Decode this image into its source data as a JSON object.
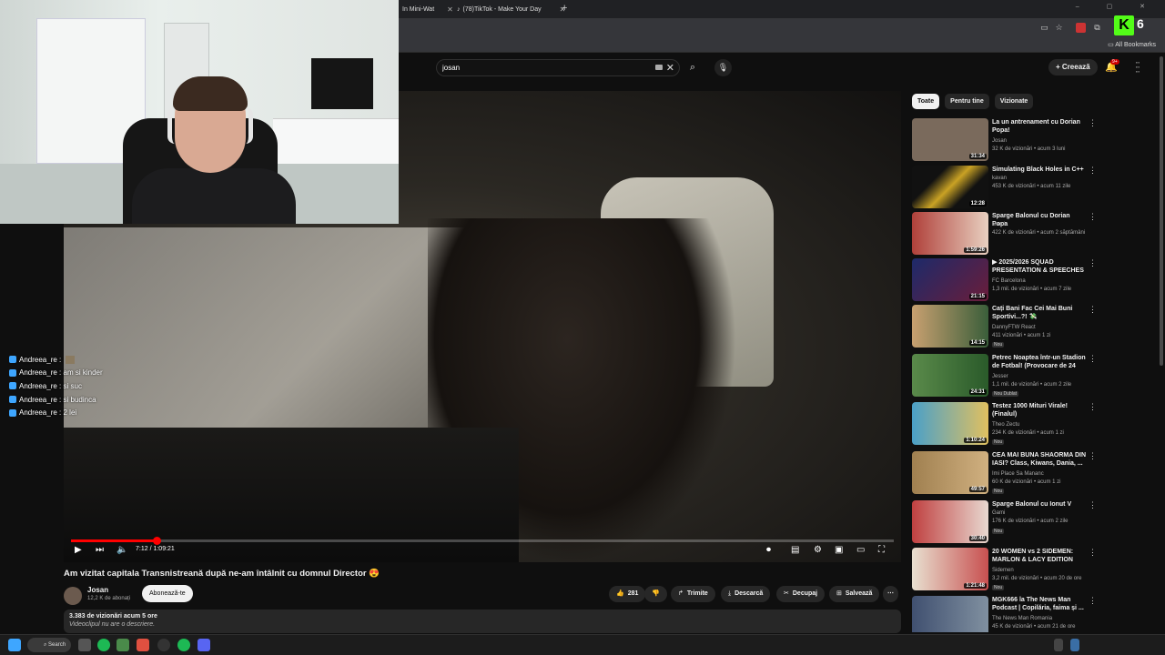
{
  "browser": {
    "tabs": [
      {
        "label": "In Mini-Wat"
      },
      {
        "label": "(78)TikTok - Make Your Day"
      }
    ],
    "all_bookmarks": "All Bookmarks"
  },
  "header": {
    "search_value": "josan",
    "create_label": "Creează",
    "notif_count": "9+"
  },
  "overlay": {
    "logo_letter": "K",
    "logo_number": "6"
  },
  "chat": [
    {
      "user": "Andreea_re :",
      "msg": ""
    },
    {
      "user": "Andreea_re :",
      "msg": "am si kinder"
    },
    {
      "user": "Andreea_re :",
      "msg": "si suc"
    },
    {
      "user": "Andreea_re :",
      "msg": "si budinca"
    },
    {
      "user": "Andreea_re :",
      "msg": "2 lei"
    }
  ],
  "player": {
    "time": "7:12 / 1:09:21",
    "progress": 0.104
  },
  "video": {
    "title": "Am vizitat capitala Transnistreană după ne-am întâlnit cu domnul Director 😍",
    "channel": "Josan",
    "subs": "12,2 K de abonați",
    "subscribe": "Abonează-te",
    "likes": "281",
    "share": "Trimite",
    "download": "Descarcă",
    "clip": "Decupaj",
    "save": "Salvează",
    "views_line": "3.383 de vizionări  acum 5 ore",
    "desc_line": "Videoclipul nu are o descriere."
  },
  "sidebar": {
    "chips": [
      "Toate",
      "Pentru tine",
      "Vizionate"
    ],
    "items": [
      {
        "title": "La un antrenament cu Dorian Popa!",
        "channel": "Josan",
        "meta": "32 K de vizionări • acum 3 luni",
        "duration": "31:34",
        "badge": "",
        "color": "#7a6a5c"
      },
      {
        "title": "Simulating Black Holes in C++",
        "channel": "kavan",
        "meta": "453 K de vizionări • acum 11 zile",
        "duration": "12:28",
        "badge": "",
        "color": "#c9a224"
      },
      {
        "title": "Sparge Balonul cu Dorian Popa",
        "channel": "Gami",
        "meta": "422 K de vizionări • acum 2 săptămâni",
        "duration": "1:59:26",
        "badge": "",
        "color": "#c8a48a"
      },
      {
        "title": "▶ 2025/2026 SQUAD PRESENTATION & SPEECHES | ...",
        "channel": "FC Barcelona",
        "meta": "1,3 mil. de vizionări • acum 7 zile",
        "duration": "21:15",
        "badge": "",
        "color": "#3a2a6a"
      },
      {
        "title": "Cați Bani Fac Cei Mai Buni Sportivi...?! 💸",
        "channel": "DannyFTW React",
        "meta": "411 vizionări • acum 1 zi",
        "duration": "14:15",
        "badge": "Nou",
        "color": "#4a5e3a"
      },
      {
        "title": "Petrec Noaptea într-un Stadion de Fotbal! (Provocare de 24 de...",
        "channel": "Jesser",
        "meta": "1,1 mil. de vizionări • acum 2 zile",
        "duration": "24:31",
        "badge": "Nou  Dublat",
        "color": "#3f6a3a"
      },
      {
        "title": "Testez 1000 Mituri Virale! (Finalul)",
        "channel": "Theo Zectu",
        "meta": "234 K de vizionări • acum 1 zi",
        "duration": "1:10:24",
        "badge": "Nou",
        "color": "#4aa0c8"
      },
      {
        "title": "CEA MAI BUNA SHAORMA DIN IASI? Class, Kiwans, Dania, ...",
        "channel": "Imi Place Sa Mananc",
        "meta": "60 K de vizionări • acum 1 zi",
        "duration": "49:57",
        "badge": "Nou",
        "color": "#a08050"
      },
      {
        "title": "Sparge Balonul cu Ionut V",
        "channel": "Gami",
        "meta": "176 K de vizionări • acum 2 zile",
        "duration": "30:40",
        "badge": "Nou",
        "color": "#d0b0a0"
      },
      {
        "title": "20 WOMEN vs 2 SIDEMEN: MARLON & LACY EDITION",
        "channel": "Sidemen",
        "meta": "3,2 mil. de vizionări • acum 20 de ore",
        "duration": "1:21:48",
        "badge": "Nou",
        "color": "#c85050"
      },
      {
        "title": "MGK666 la The News Man Podcast | Copilăria, faima și ...",
        "channel": "The News Man Romania",
        "meta": "45 K de vizionări • acum 21 de ore",
        "duration": "",
        "badge": "",
        "color": "#405070"
      }
    ]
  },
  "taskbar": {
    "search_label": "Search"
  }
}
